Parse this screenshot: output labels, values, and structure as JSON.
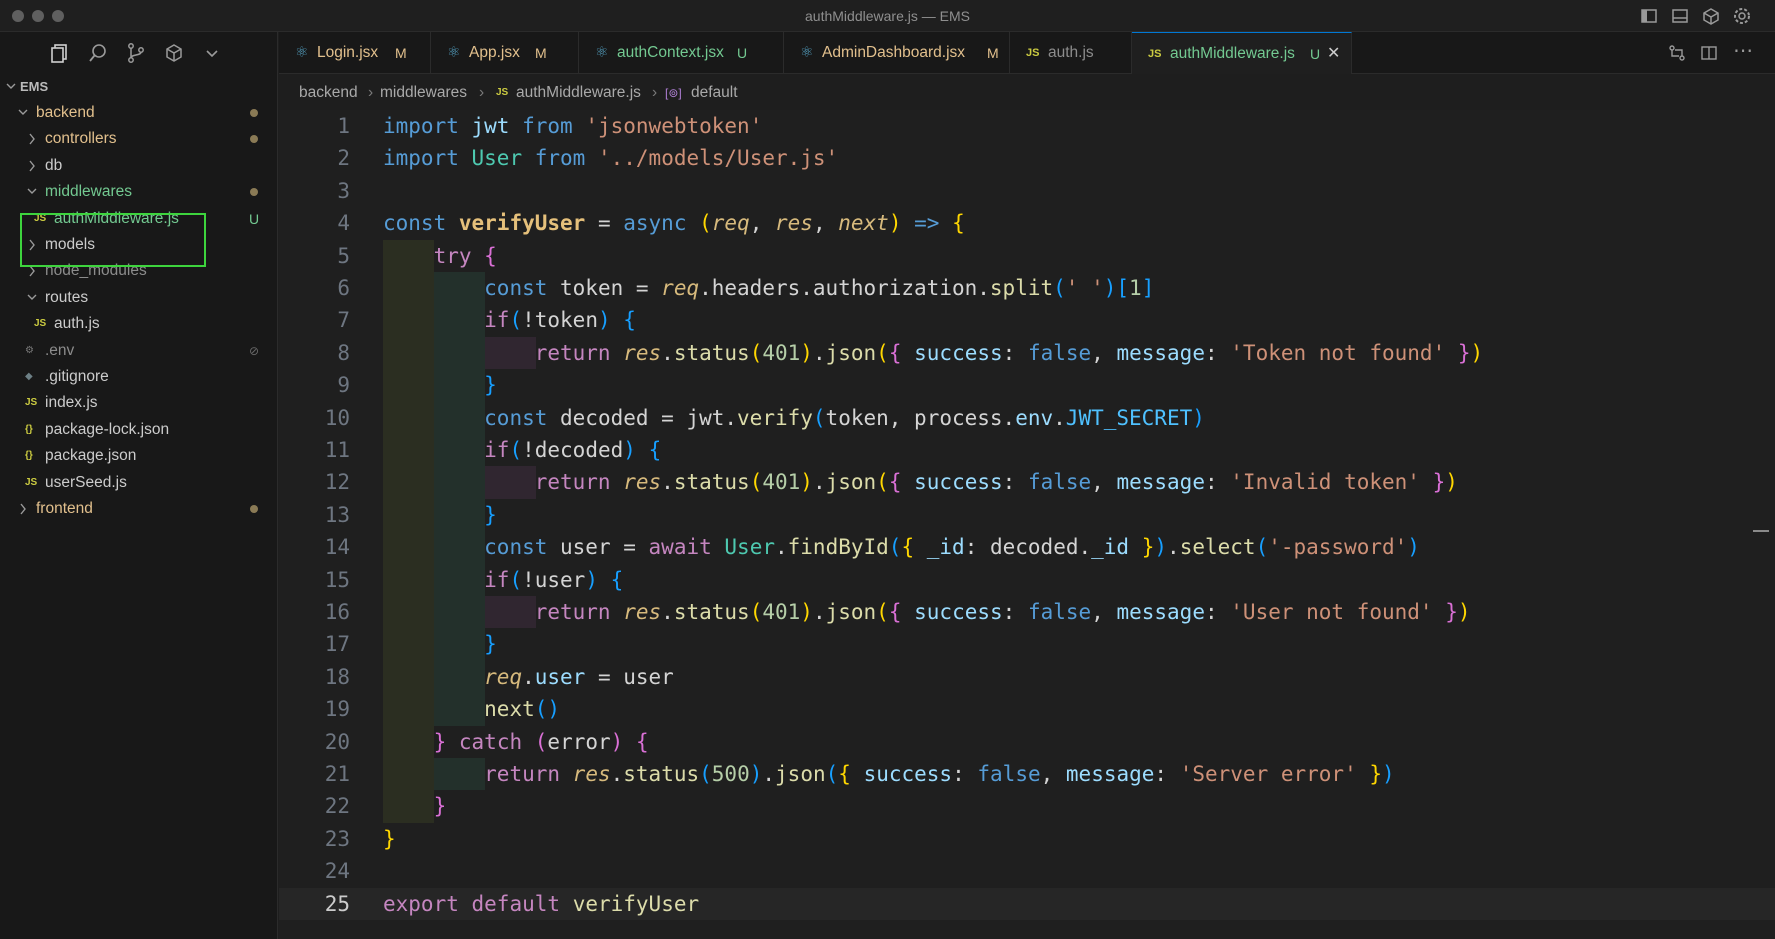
{
  "window": {
    "title": "authMiddleware.js — EMS"
  },
  "explorer": {
    "root": "EMS",
    "items": [
      {
        "label": "backend",
        "depth": 0,
        "type": "folder",
        "open": true,
        "color": "#e2c08d",
        "dot": true
      },
      {
        "label": "controllers",
        "depth": 1,
        "type": "folder",
        "open": false,
        "color": "#e2c08d",
        "dot": true
      },
      {
        "label": "db",
        "depth": 1,
        "type": "folder",
        "open": false,
        "color": "#cccccc"
      },
      {
        "label": "middlewares",
        "depth": 1,
        "type": "folder",
        "open": true,
        "color": "#73c991",
        "dot": true
      },
      {
        "label": "authMiddleware.js",
        "depth": 2,
        "type": "js",
        "color": "#73c991",
        "badge": "U"
      },
      {
        "label": "models",
        "depth": 1,
        "type": "folder",
        "open": false,
        "color": "#cccccc"
      },
      {
        "label": "node_modules",
        "depth": 1,
        "type": "folder",
        "open": false,
        "color": "#8c8c8c"
      },
      {
        "label": "routes",
        "depth": 1,
        "type": "folder",
        "open": true,
        "color": "#cccccc"
      },
      {
        "label": "auth.js",
        "depth": 2,
        "type": "js",
        "color": "#cccccc"
      },
      {
        "label": ".env",
        "depth": 1,
        "type": "gear",
        "color": "#8c8c8c"
      },
      {
        "label": ".gitignore",
        "depth": 1,
        "type": "git",
        "color": "#cccccc"
      },
      {
        "label": "index.js",
        "depth": 1,
        "type": "js",
        "color": "#cccccc"
      },
      {
        "label": "package-lock.json",
        "depth": 1,
        "type": "json",
        "color": "#cccccc"
      },
      {
        "label": "package.json",
        "depth": 1,
        "type": "json",
        "color": "#cccccc"
      },
      {
        "label": "userSeed.js",
        "depth": 1,
        "type": "js",
        "color": "#cccccc"
      },
      {
        "label": "frontend",
        "depth": 0,
        "type": "folder",
        "open": false,
        "color": "#e2c08d",
        "dot": true
      }
    ]
  },
  "tabs": [
    {
      "name": "Login.jsx",
      "status": "M",
      "icon": "⚛",
      "color": "#e2c08d"
    },
    {
      "name": "App.jsx",
      "status": "M",
      "icon": "⚛",
      "color": "#e2c08d"
    },
    {
      "name": "authContext.jsx",
      "status": "U",
      "icon": "⚛",
      "color": "#73c991"
    },
    {
      "name": "AdminDashboard.jsx",
      "status": "M",
      "icon": "⚛",
      "color": "#e2c08d"
    },
    {
      "name": "auth.js",
      "status": "",
      "icon": "JS",
      "color": "#8c8c8c"
    },
    {
      "name": "authMiddleware.js",
      "status": "U",
      "icon": "JS",
      "color": "#73c991",
      "active": true
    }
  ],
  "breadcrumb": {
    "part1": "backend",
    "part2": "middlewares",
    "part3": "authMiddleware.js",
    "part4": "default"
  },
  "code": {
    "line_numbers": [
      "1",
      "2",
      "3",
      "4",
      "5",
      "6",
      "7",
      "8",
      "9",
      "10",
      "11",
      "12",
      "13",
      "14",
      "15",
      "16",
      "17",
      "18",
      "19",
      "20",
      "21",
      "22",
      "23",
      "24",
      "25"
    ],
    "lines": [
      [
        [
          "kw",
          "import"
        ],
        [
          "var",
          " "
        ],
        [
          "prop",
          "jwt"
        ],
        [
          "var",
          " "
        ],
        [
          "kw",
          "from"
        ],
        [
          "var",
          " "
        ],
        [
          "str",
          "'jsonwebtoken'"
        ]
      ],
      [
        [
          "kw",
          "import"
        ],
        [
          "var",
          " "
        ],
        [
          "cls",
          "User"
        ],
        [
          "var",
          " "
        ],
        [
          "kw",
          "from"
        ],
        [
          "var",
          " "
        ],
        [
          "str",
          "'../models/User.js'"
        ]
      ],
      [],
      [
        [
          "kw",
          "const"
        ],
        [
          "var",
          " "
        ],
        [
          "fnb",
          "verifyUser"
        ],
        [
          "var",
          " = "
        ],
        [
          "kw",
          "async"
        ],
        [
          "var",
          " "
        ],
        [
          "b1",
          "("
        ],
        [
          "par",
          "req"
        ],
        [
          "var",
          ", "
        ],
        [
          "par",
          "res"
        ],
        [
          "var",
          ", "
        ],
        [
          "par",
          "next"
        ],
        [
          "b1",
          ")"
        ],
        [
          "var",
          " "
        ],
        [
          "kw",
          "=>"
        ],
        [
          "var",
          " "
        ],
        [
          "b1",
          "{"
        ]
      ],
      [
        [
          "var",
          "    "
        ],
        [
          "kw2",
          "try"
        ],
        [
          "var",
          " "
        ],
        [
          "b2",
          "{"
        ]
      ],
      [
        [
          "var",
          "        "
        ],
        [
          "kw",
          "const"
        ],
        [
          "var",
          " token = "
        ],
        [
          "par",
          "req"
        ],
        [
          "var",
          ".headers.authorization."
        ],
        [
          "fn",
          "split"
        ],
        [
          "b3",
          "("
        ],
        [
          "str",
          "' '"
        ],
        [
          "b3",
          ")"
        ],
        [
          "b3",
          "["
        ],
        [
          "num",
          "1"
        ],
        [
          "b3",
          "]"
        ]
      ],
      [
        [
          "var",
          "        "
        ],
        [
          "kw2",
          "if"
        ],
        [
          "b3",
          "("
        ],
        [
          "var",
          "!token"
        ],
        [
          "b3",
          ")"
        ],
        [
          "var",
          " "
        ],
        [
          "b3",
          "{"
        ]
      ],
      [
        [
          "var",
          "            "
        ],
        [
          "kw2",
          "return"
        ],
        [
          "var",
          " "
        ],
        [
          "par",
          "res"
        ],
        [
          "var",
          "."
        ],
        [
          "fn",
          "status"
        ],
        [
          "b1",
          "("
        ],
        [
          "num",
          "401"
        ],
        [
          "b1",
          ")"
        ],
        [
          "var",
          "."
        ],
        [
          "fn",
          "json"
        ],
        [
          "b1",
          "("
        ],
        [
          "b2",
          "{"
        ],
        [
          "var",
          " "
        ],
        [
          "prop",
          "success"
        ],
        [
          "var",
          ": "
        ],
        [
          "kw",
          "false"
        ],
        [
          "var",
          ", "
        ],
        [
          "prop",
          "message"
        ],
        [
          "var",
          ": "
        ],
        [
          "str",
          "'Token not found'"
        ],
        [
          "var",
          " "
        ],
        [
          "b2",
          "}"
        ],
        [
          "b1",
          ")"
        ]
      ],
      [
        [
          "var",
          "        "
        ],
        [
          "b3",
          "}"
        ]
      ],
      [
        [
          "var",
          "        "
        ],
        [
          "kw",
          "const"
        ],
        [
          "var",
          " decoded = jwt."
        ],
        [
          "fn",
          "verify"
        ],
        [
          "b3",
          "("
        ],
        [
          "var",
          "token, process."
        ],
        [
          "prop",
          "env"
        ],
        [
          "var",
          "."
        ],
        [
          "env",
          "JWT_SECRET"
        ],
        [
          "b3",
          ")"
        ]
      ],
      [
        [
          "var",
          "        "
        ],
        [
          "kw2",
          "if"
        ],
        [
          "b3",
          "("
        ],
        [
          "var",
          "!decoded"
        ],
        [
          "b3",
          ")"
        ],
        [
          "var",
          " "
        ],
        [
          "b3",
          "{"
        ]
      ],
      [
        [
          "var",
          "            "
        ],
        [
          "kw2",
          "return"
        ],
        [
          "var",
          " "
        ],
        [
          "par",
          "res"
        ],
        [
          "var",
          "."
        ],
        [
          "fn",
          "status"
        ],
        [
          "b1",
          "("
        ],
        [
          "num",
          "401"
        ],
        [
          "b1",
          ")"
        ],
        [
          "var",
          "."
        ],
        [
          "fn",
          "json"
        ],
        [
          "b1",
          "("
        ],
        [
          "b2",
          "{"
        ],
        [
          "var",
          " "
        ],
        [
          "prop",
          "success"
        ],
        [
          "var",
          ": "
        ],
        [
          "kw",
          "false"
        ],
        [
          "var",
          ", "
        ],
        [
          "prop",
          "message"
        ],
        [
          "var",
          ": "
        ],
        [
          "str",
          "'Invalid token'"
        ],
        [
          "var",
          " "
        ],
        [
          "b2",
          "}"
        ],
        [
          "b1",
          ")"
        ]
      ],
      [
        [
          "var",
          "        "
        ],
        [
          "b3",
          "}"
        ]
      ],
      [
        [
          "var",
          "        "
        ],
        [
          "kw",
          "const"
        ],
        [
          "var",
          " user = "
        ],
        [
          "kw2",
          "await"
        ],
        [
          "var",
          " "
        ],
        [
          "cls",
          "User"
        ],
        [
          "var",
          "."
        ],
        [
          "fn",
          "findById"
        ],
        [
          "b3",
          "("
        ],
        [
          "b1",
          "{"
        ],
        [
          "var",
          " "
        ],
        [
          "prop",
          "_id"
        ],
        [
          "var",
          ": decoded."
        ],
        [
          "prop",
          "_id"
        ],
        [
          "var",
          " "
        ],
        [
          "b1",
          "}"
        ],
        [
          "b3",
          ")"
        ],
        [
          "var",
          "."
        ],
        [
          "fn",
          "select"
        ],
        [
          "b3",
          "("
        ],
        [
          "str",
          "'-password'"
        ],
        [
          "b3",
          ")"
        ]
      ],
      [
        [
          "var",
          "        "
        ],
        [
          "kw2",
          "if"
        ],
        [
          "b3",
          "("
        ],
        [
          "var",
          "!user"
        ],
        [
          "b3",
          ")"
        ],
        [
          "var",
          " "
        ],
        [
          "b3",
          "{"
        ]
      ],
      [
        [
          "var",
          "            "
        ],
        [
          "kw2",
          "return"
        ],
        [
          "var",
          " "
        ],
        [
          "par",
          "res"
        ],
        [
          "var",
          "."
        ],
        [
          "fn",
          "status"
        ],
        [
          "b1",
          "("
        ],
        [
          "num",
          "401"
        ],
        [
          "b1",
          ")"
        ],
        [
          "var",
          "."
        ],
        [
          "fn",
          "json"
        ],
        [
          "b1",
          "("
        ],
        [
          "b2",
          "{"
        ],
        [
          "var",
          " "
        ],
        [
          "prop",
          "success"
        ],
        [
          "var",
          ": "
        ],
        [
          "kw",
          "false"
        ],
        [
          "var",
          ", "
        ],
        [
          "prop",
          "message"
        ],
        [
          "var",
          ": "
        ],
        [
          "str",
          "'User not found'"
        ],
        [
          "var",
          " "
        ],
        [
          "b2",
          "}"
        ],
        [
          "b1",
          ")"
        ]
      ],
      [
        [
          "var",
          "        "
        ],
        [
          "b3",
          "}"
        ]
      ],
      [
        [
          "var",
          "        "
        ],
        [
          "par",
          "req"
        ],
        [
          "var",
          "."
        ],
        [
          "prop",
          "user"
        ],
        [
          "var",
          " = user"
        ]
      ],
      [
        [
          "var",
          "        "
        ],
        [
          "fn",
          "next"
        ],
        [
          "b3",
          "()"
        ]
      ],
      [
        [
          "var",
          "    "
        ],
        [
          "b2",
          "}"
        ],
        [
          "var",
          " "
        ],
        [
          "kw2",
          "catch"
        ],
        [
          "var",
          " "
        ],
        [
          "b2",
          "("
        ],
        [
          "var",
          "error"
        ],
        [
          "b2",
          ")"
        ],
        [
          "var",
          " "
        ],
        [
          "b2",
          "{"
        ]
      ],
      [
        [
          "var",
          "        "
        ],
        [
          "kw2",
          "return"
        ],
        [
          "var",
          " "
        ],
        [
          "par",
          "res"
        ],
        [
          "var",
          "."
        ],
        [
          "fn",
          "status"
        ],
        [
          "b3",
          "("
        ],
        [
          "num",
          "500"
        ],
        [
          "b3",
          ")"
        ],
        [
          "var",
          "."
        ],
        [
          "fn",
          "json"
        ],
        [
          "b3",
          "("
        ],
        [
          "b1",
          "{"
        ],
        [
          "var",
          " "
        ],
        [
          "prop",
          "success"
        ],
        [
          "var",
          ": "
        ],
        [
          "kw",
          "false"
        ],
        [
          "var",
          ", "
        ],
        [
          "prop",
          "message"
        ],
        [
          "var",
          ": "
        ],
        [
          "str",
          "'Server error'"
        ],
        [
          "var",
          " "
        ],
        [
          "b1",
          "}"
        ],
        [
          "b3",
          ")"
        ]
      ],
      [
        [
          "var",
          "    "
        ],
        [
          "b2",
          "}"
        ]
      ],
      [
        [
          "b1",
          "}"
        ]
      ],
      [],
      [
        [
          "kw2",
          "export"
        ],
        [
          "var",
          " "
        ],
        [
          "kw2",
          "default"
        ],
        [
          "var",
          " "
        ],
        [
          "fn",
          "verifyUser"
        ]
      ]
    ]
  }
}
